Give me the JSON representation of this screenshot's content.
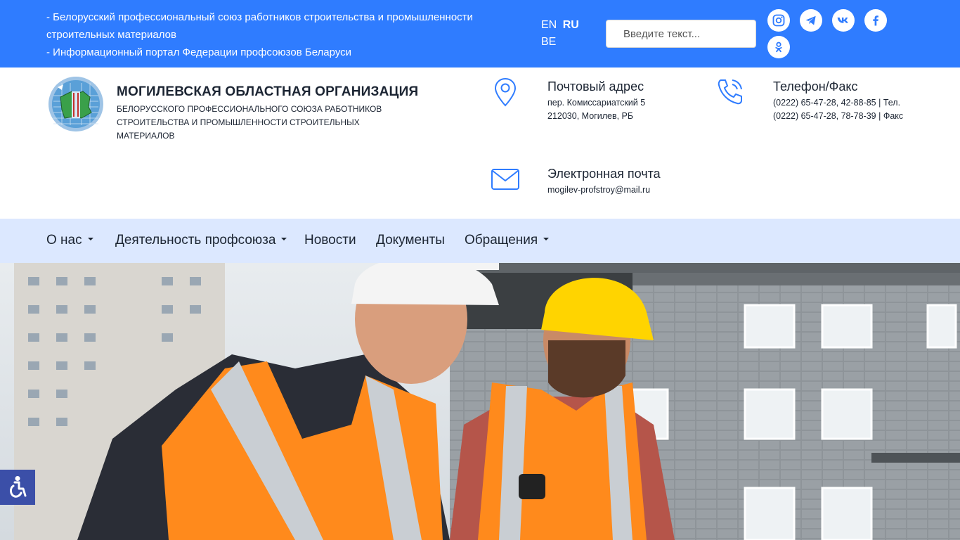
{
  "topbar": {
    "links": [
      "- Белорусский профессиональный союз работников строительства и промышленности строительных материалов",
      "- Информационный портал Федерации профсоюзов Беларуси"
    ],
    "languages": [
      "EN",
      "RU",
      "BE"
    ],
    "active_language": "RU",
    "search_placeholder": "Введите текст...",
    "social": [
      "instagram-icon",
      "telegram-icon",
      "vk-icon",
      "facebook-icon",
      "odnoklassniki-icon"
    ],
    "color": "#2f7cff"
  },
  "header": {
    "title": "МОГИЛЕВСКАЯ ОБЛАСТНАЯ ОРГАНИЗАЦИЯ",
    "subtitle_line1": "БЕЛОРУССКОГО ПРОФЕССИОНАЛЬНОГО СОЮЗА РАБОТНИКОВ",
    "subtitle_line2": "СТРОИТЕЛЬСТВА И ПРОМЫШЛЕННОСТИ СТРОИТЕЛЬНЫХ МАТЕРИАЛОВ"
  },
  "contacts": {
    "postal": {
      "title": "Почтовый адрес",
      "line1": "пер. Комиссариатский 5",
      "line2": "212030, Могилев, РБ"
    },
    "phone": {
      "title": "Телефон/Факс",
      "line1": "(0222) 65-47-28, 42-88-85 | Тел.",
      "line2": "(0222) 65-47-28, 78-78-39 | Факс"
    },
    "email": {
      "title": "Электронная почта",
      "line1": "mogilev-profstroy@mail.ru"
    }
  },
  "nav": {
    "items": [
      "О нас",
      "Деятельность профсоюза",
      "Новости",
      "Документы",
      "Обращения"
    ],
    "color": "#dce8ff"
  }
}
